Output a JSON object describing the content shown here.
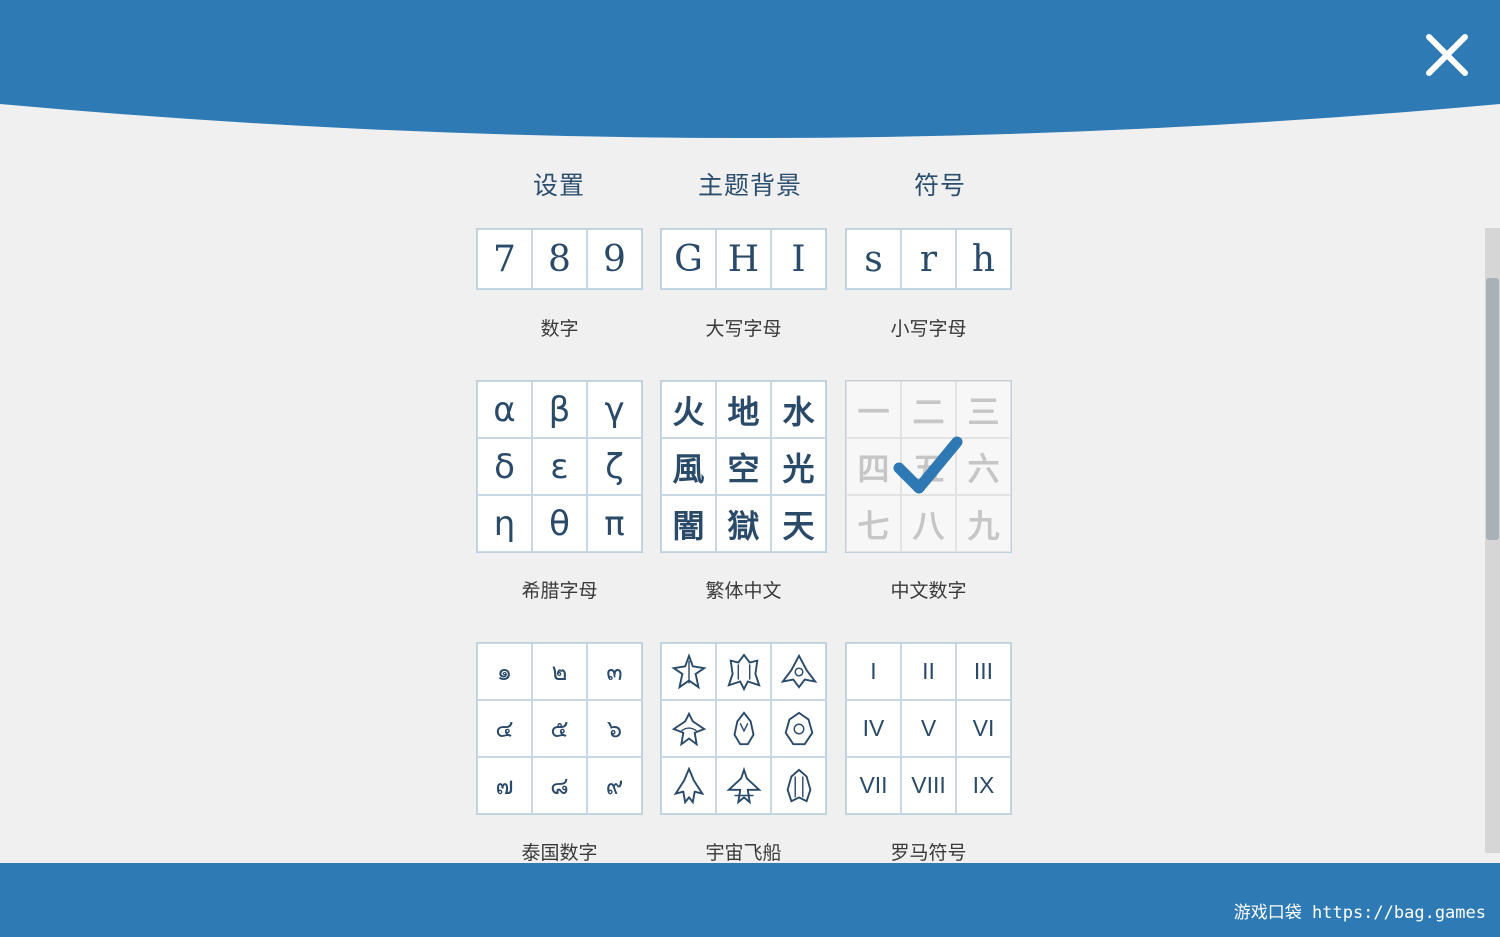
{
  "colors": {
    "primary": "#2e7ab5",
    "background": "#f0f0f0",
    "check": "#2e78b3"
  },
  "header": {
    "close_icon": "close-icon"
  },
  "tabs": [
    {
      "label": "设置"
    },
    {
      "label": "主题背景"
    },
    {
      "label": "符号"
    }
  ],
  "symbol_sets": [
    {
      "caption": "数字",
      "cells": [
        "7",
        "8",
        "9"
      ],
      "selected": false
    },
    {
      "caption": "大写字母",
      "cells": [
        "G",
        "H",
        "I"
      ],
      "selected": false
    },
    {
      "caption": "小写字母",
      "cells": [
        "s",
        "r",
        "h"
      ],
      "selected": false
    },
    {
      "caption": "希腊字母",
      "cells": [
        "α",
        "β",
        "γ",
        "δ",
        "ε",
        "ζ",
        "η",
        "θ",
        "π"
      ],
      "selected": false
    },
    {
      "caption": "繁体中文",
      "cells": [
        "火",
        "地",
        "水",
        "風",
        "空",
        "光",
        "闇",
        "獄",
        "天"
      ],
      "selected": false
    },
    {
      "caption": "中文数字",
      "cells": [
        "一",
        "二",
        "三",
        "四",
        "五",
        "六",
        "七",
        "八",
        "九"
      ],
      "selected": true
    },
    {
      "caption": "泰国数字",
      "cells": [
        "๑",
        "๒",
        "๓",
        "๔",
        "๕",
        "๖",
        "๗",
        "๘",
        "๙"
      ],
      "selected": false
    },
    {
      "caption": "宇宙飞船",
      "cells": [
        "spaceship-icon",
        "spaceship-icon",
        "spaceship-icon",
        "spaceship-icon",
        "spaceship-icon",
        "spaceship-icon",
        "spaceship-icon",
        "spaceship-icon",
        "spaceship-icon"
      ],
      "selected": false
    },
    {
      "caption": "罗马符号",
      "cells": [
        "I",
        "II",
        "III",
        "IV",
        "V",
        "VI",
        "VII",
        "VIII",
        "IX"
      ],
      "selected": false
    }
  ],
  "footer": {
    "watermark": "游戏口袋 https://bag.games"
  }
}
